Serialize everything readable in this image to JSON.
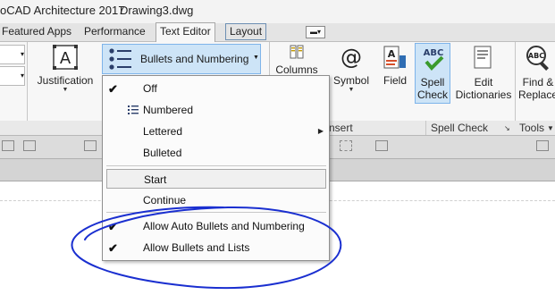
{
  "window": {
    "title": "oCAD Architecture 2017",
    "document": "Drawing3.dwg"
  },
  "tabs": [
    {
      "label": "Featured Apps"
    },
    {
      "label": "Performance"
    },
    {
      "label": "Text Editor"
    },
    {
      "label": "Layout"
    }
  ],
  "ribbon": {
    "justification_label": "Justification",
    "bullets_label": "Bullets and Numbering",
    "columns_label": "Columns",
    "symbol_label": "Symbol",
    "field_label": "Field",
    "spell_check_line1": "Spell",
    "spell_check_line2": "Check",
    "edit_dict_line1": "Edit",
    "edit_dict_line2": "Dictionaries",
    "find_line1": "Find &",
    "find_line2": "Replace",
    "panels": {
      "insert": "nsert",
      "spell_check": "Spell Check",
      "tools": "Tools"
    }
  },
  "menu": {
    "items": [
      {
        "label": "Off",
        "checked": true
      },
      {
        "label": "Numbered",
        "checked": false
      },
      {
        "label": "Lettered",
        "checked": false,
        "submenu": true
      },
      {
        "label": "Bulleted",
        "checked": false
      },
      {
        "label": "Start",
        "checked": false,
        "highlighted": true
      },
      {
        "label": "Continue",
        "checked": false
      },
      {
        "label": "Allow Auto Bullets and Numbering",
        "checked": true
      },
      {
        "label": "Allow Bullets and Lists",
        "checked": true
      }
    ]
  },
  "colors": {
    "selected_fill": "#cde4f7",
    "selected_border": "#7eb4ea",
    "annotation_ink": "#1a2fd0"
  },
  "icons": [
    "check-icon",
    "bullet-list-icon",
    "numbered-list-icon",
    "submenu-arrow-icon",
    "justification-icon",
    "columns-icon",
    "at-symbol-icon",
    "field-icon",
    "spell-check-icon",
    "edit-dictionary-icon",
    "find-replace-icon"
  ]
}
